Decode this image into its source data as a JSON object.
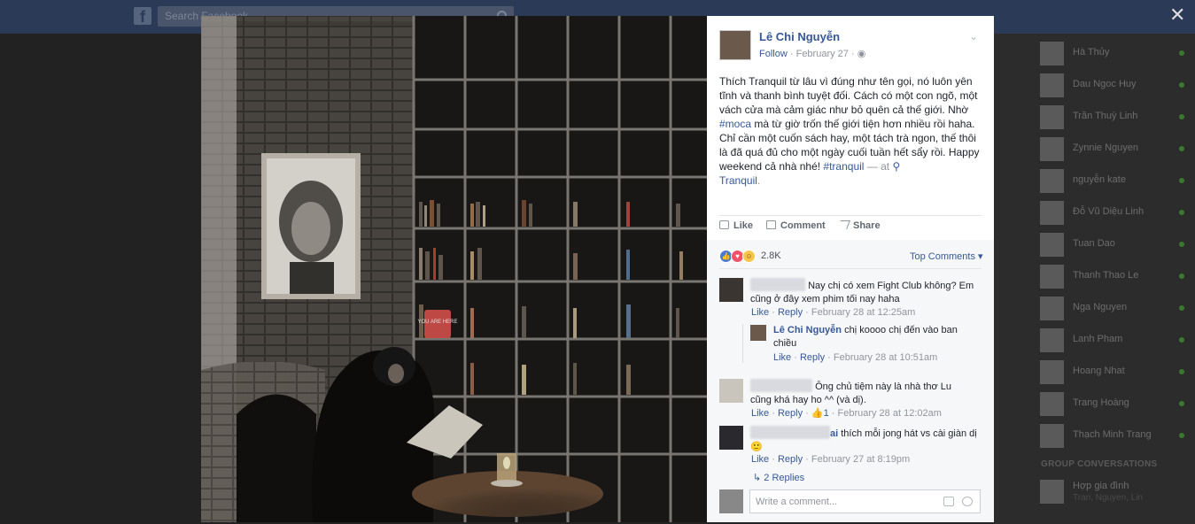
{
  "topbar": {
    "search_placeholder": "Search Facebook",
    "logo": "f"
  },
  "close_label": "✕",
  "sidebar": {
    "contacts": [
      {
        "name": "Hà Thủy"
      },
      {
        "name": "Dau Ngoc Huy"
      },
      {
        "name": "Trần Thuỳ Linh"
      },
      {
        "name": "Zynnie Nguyen"
      },
      {
        "name": "nguyễn kate"
      },
      {
        "name": "Đỗ Vũ Diệu Linh"
      },
      {
        "name": "Tuan Dao"
      },
      {
        "name": "Thanh Thao Le"
      },
      {
        "name": "Nga Nguyen"
      },
      {
        "name": "Lanh Pham"
      },
      {
        "name": "Hoang Nhat"
      },
      {
        "name": "Trang Hoàng"
      },
      {
        "name": "Thạch Minh Trang"
      }
    ],
    "group_title": "GROUP CONVERSATIONS",
    "group_name": "Hợp gia đình",
    "group_sub": "Tran, Nguyen, Lin"
  },
  "photo": {
    "sign_text": "YOU ARE HERE"
  },
  "post": {
    "author": "Lê Chi Nguyễn",
    "follow": "Follow",
    "date": "February 27",
    "body_1": "Thích Tranquil từ lâu vì đúng như tên gọi, nó luôn yên tĩnh và thanh bình tuyệt đối. Cách có một con ngõ, một vách cửa mà cảm giác như bỏ quên cả thế giới. Nhờ ",
    "hashtag_moca": "#moca",
    "body_2": " mà từ giờ trốn thế giới tiện hơn nhiều rồi haha.",
    "body_3": "Chỉ cần một cuốn sách hay, một tách trà ngon, thế thôi là đã quá đủ cho một ngày cuối tuần hết sẩy rồi. Happy weekend cả nhà nhé! ",
    "hashtag_tranquil": "#tranquil",
    "at_text": " — at ",
    "place": "Tranquil",
    "place_suffix": "."
  },
  "actions": {
    "like": "Like",
    "comment": "Comment",
    "share": "Share"
  },
  "reactions": {
    "count": "2.8K",
    "top_comments": "Top Comments ▾"
  },
  "comments": [
    {
      "text": "Nay chị có xem Fight Club không? Em cũng ở đây xem phim tối nay haha",
      "like": "Like",
      "reply": "Reply",
      "time": "February 28 at 12:25am"
    },
    {
      "author": "Lê Chi Nguyễn",
      "text": "chị koooo chị đến vào ban chiều",
      "like": "Like",
      "reply": "Reply",
      "time": "February 28 at 10:51am"
    },
    {
      "text": "Ông chủ tiệm này là nhà thơ Lu cũng khá hay ho ^^ (và dị).",
      "like": "Like",
      "reply": "Reply",
      "likes": "1",
      "time": "February 28 at 12:02am"
    },
    {
      "name_tail": "ai",
      "text": "thích mỗi jong hát vs cài giàn dị",
      "emoji": "🙂",
      "like": "Like",
      "reply": "Reply",
      "time": "February 27 at 8:19pm"
    }
  ],
  "replies_link": "2 Replies",
  "write_placeholder": "Write a comment..."
}
